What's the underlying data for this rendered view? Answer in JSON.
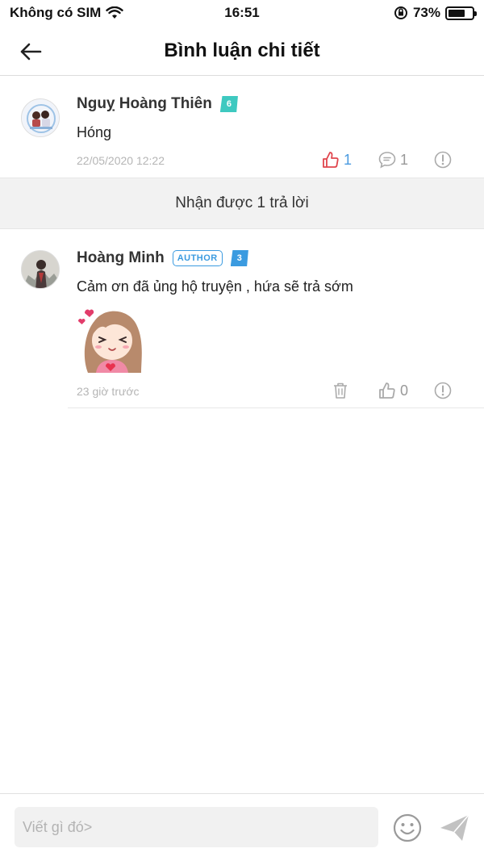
{
  "status_bar": {
    "carrier": "Không có SIM",
    "time": "16:51",
    "battery_text": "73%",
    "battery_level": 0.73
  },
  "header": {
    "title": "Bình luận chi tiết"
  },
  "comment": {
    "user_name": "Nguỵ Hoàng Thiên",
    "level_badge": "6",
    "level_color": "#3ec9c0",
    "text": "Hóng",
    "timestamp": "22/05/2020 12:22",
    "like_count": "1",
    "reply_count": "1"
  },
  "reply_banner": {
    "text": "Nhận được 1 trả lời"
  },
  "reply": {
    "user_name": "Hoàng Minh",
    "author_badge": "AUTHOR",
    "level_badge": "3",
    "level_color": "#3b9be0",
    "text": "Cảm ơn đã ủng hộ truyện , hứa sẽ trả sớm",
    "timestamp": "23 giờ trước",
    "like_count": "0"
  },
  "input": {
    "placeholder": "Viết gì đó>"
  },
  "colors": {
    "like_active": "#e0454d",
    "count_active": "#4a9be0",
    "icon_gray": "#aaaaaa"
  }
}
